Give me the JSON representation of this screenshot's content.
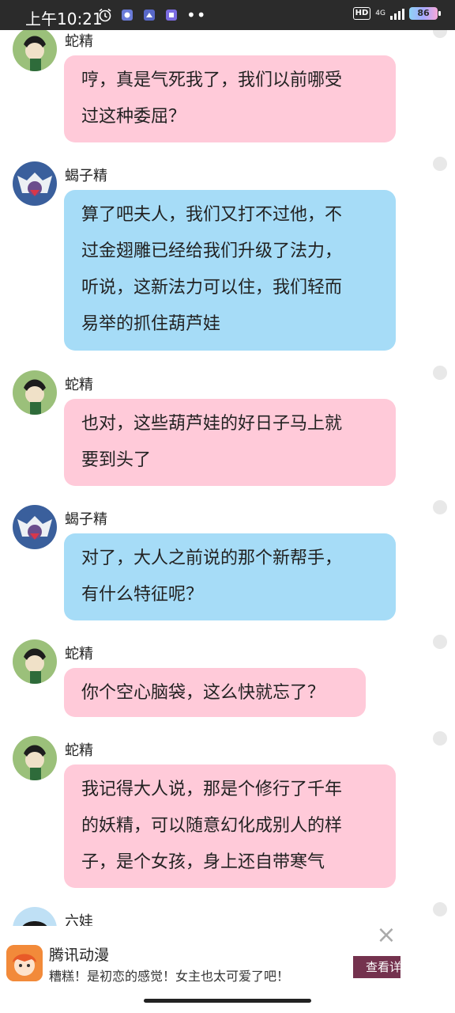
{
  "status_bar": {
    "time": "上午10:21",
    "hd": "HD",
    "network": "4G",
    "battery": "86"
  },
  "messages": [
    {
      "sender": "蛇精",
      "avatar": "snake-avatar",
      "color": "pink",
      "text": "哼，真是气死我了，我们以前哪受\n过这种委屈？"
    },
    {
      "sender": "蝎子精",
      "avatar": "scorpion-avatar",
      "color": "blue",
      "text": "算了吧夫人，我们又打不过他，不\n过金翅雕已经给我们升级了法力，\n听说，这新法力可以住，我们轻而\n易举的抓住葫芦娃"
    },
    {
      "sender": "蛇精",
      "avatar": "snake-avatar",
      "color": "pink",
      "text": "也对，这些葫芦娃的好日子马上就\n要到头了"
    },
    {
      "sender": "蝎子精",
      "avatar": "scorpion-avatar",
      "color": "blue",
      "text": "对了，大人之前说的那个新帮手，\n有什么特征呢？"
    },
    {
      "sender": "蛇精",
      "avatar": "snake-avatar",
      "color": "pink",
      "text": "你个空心脑袋，这么快就忘了？"
    },
    {
      "sender": "蛇精",
      "avatar": "snake-avatar",
      "color": "pink",
      "text": "我记得大人说，那是个修行了千年\n的妖精，可以随意幻化成别人的样\n子，是个女孩，身上还自带寒气"
    },
    {
      "sender": "六娃",
      "avatar": "liuwa-avatar",
      "color": "none",
      "text": ""
    }
  ],
  "ad": {
    "title": "腾讯动漫",
    "subtitle": "糟糕！是初恋的感觉！女主也太可爱了吧！",
    "button": "查看详情"
  }
}
